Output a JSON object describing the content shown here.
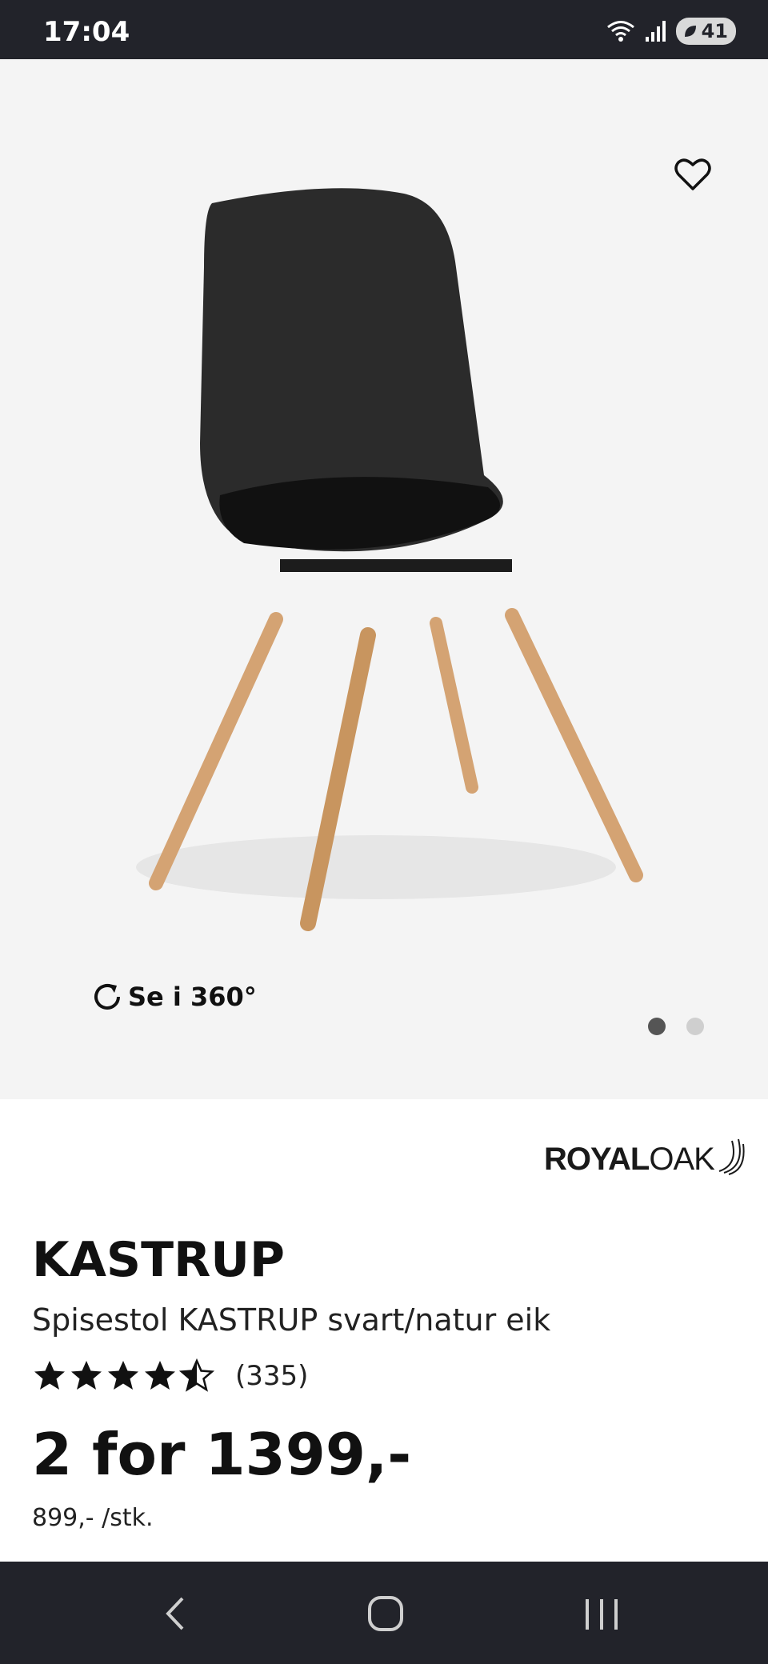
{
  "status_bar": {
    "time": "17:04",
    "battery_level": "41"
  },
  "product_image": {
    "rotate_label": "Se i 360°",
    "active_slide": 1,
    "slides": 2
  },
  "brand": {
    "part1": "ROYAL",
    "part2": "OAK"
  },
  "product": {
    "name": "KASTRUP",
    "description": "Spisestol KASTRUP svart/natur eik",
    "rating": 4.5,
    "review_count": "(335)",
    "price": "2 for 1399,-",
    "unit_price": "899,- /stk."
  },
  "colors": {
    "accent_dark": "#22232a",
    "dot_active": "#555555",
    "dot_inactive": "#cfcfcf"
  }
}
